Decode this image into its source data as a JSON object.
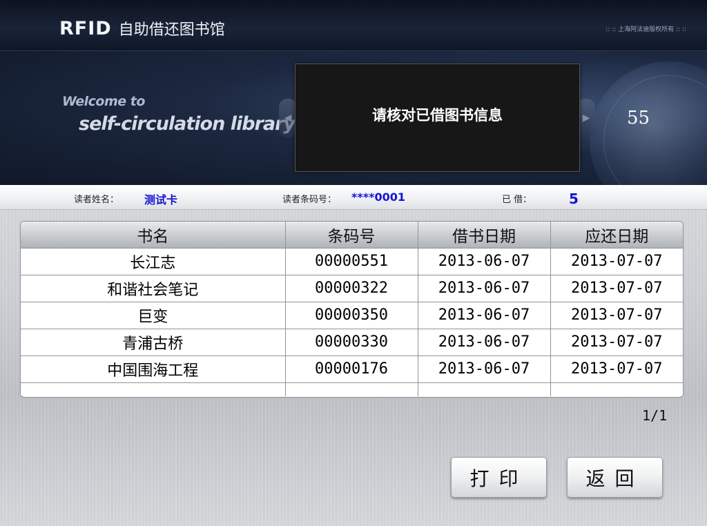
{
  "header": {
    "brand": "RFID",
    "app_title": "自助借还图书馆",
    "copyright": ":: :: 上海阿法迪版权所有 :: ::"
  },
  "banner": {
    "welcome_line1": "Welcome to",
    "welcome_line2": "self-circulation library",
    "message": "请核对已借图书信息",
    "countdown": "55"
  },
  "reader": {
    "name_label": "读者姓名：",
    "name_value": "测试卡",
    "barcode_label": "读者条码号：",
    "barcode_value": "****0001",
    "borrowed_label": "已  借：",
    "borrowed_value": "5"
  },
  "table": {
    "headers": [
      "书名",
      "条码号",
      "借书日期",
      "应还日期"
    ],
    "rows": [
      [
        "长江志",
        "00000551",
        "2013-06-07",
        "2013-07-07"
      ],
      [
        "和谐社会笔记",
        "00000322",
        "2013-06-07",
        "2013-07-07"
      ],
      [
        "巨变",
        "00000350",
        "2013-06-07",
        "2013-07-07"
      ],
      [
        "青浦古桥",
        "00000330",
        "2013-06-07",
        "2013-07-07"
      ],
      [
        "中国围海工程",
        "00000176",
        "2013-06-07",
        "2013-07-07"
      ]
    ]
  },
  "pager": "1/1",
  "buttons": {
    "print": "打印",
    "back": "返回"
  }
}
